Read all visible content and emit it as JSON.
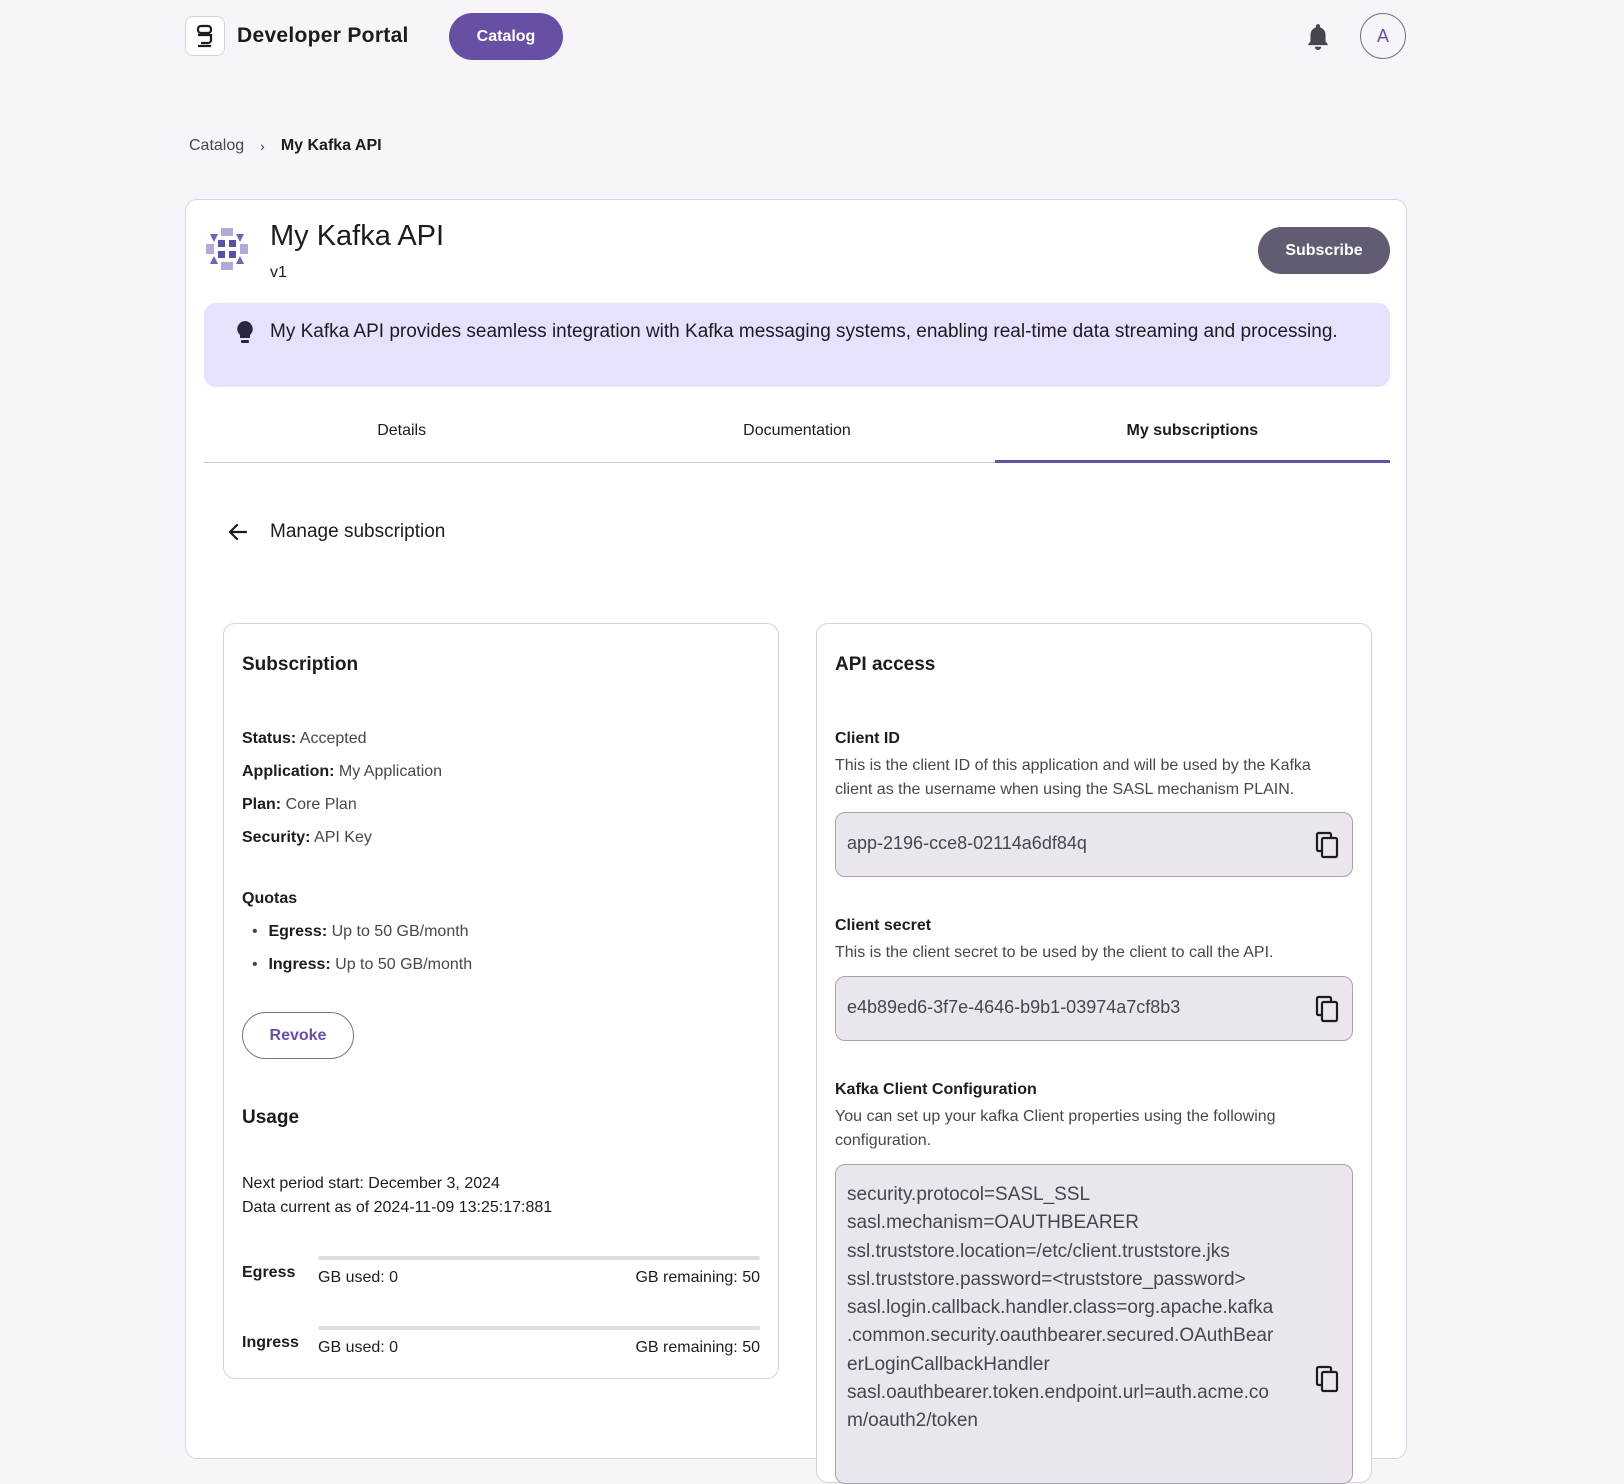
{
  "header": {
    "brand": "Developer Portal",
    "nav_catalog": "Catalog",
    "avatar_initial": "A"
  },
  "breadcrumb": {
    "root": "Catalog",
    "current": "My Kafka API"
  },
  "api": {
    "title": "My Kafka API",
    "version": "v1",
    "subscribe_label": "Subscribe",
    "description": "My Kafka API provides seamless integration with Kafka messaging systems, enabling real-time data streaming and processing."
  },
  "tabs": [
    {
      "label": "Details"
    },
    {
      "label": "Documentation"
    },
    {
      "label": "My subscriptions"
    }
  ],
  "manage": {
    "title": "Manage subscription"
  },
  "subscription": {
    "title": "Subscription",
    "status_label": "Status:",
    "status": "Accepted",
    "application_label": "Application:",
    "application": "My Application",
    "plan_label": "Plan:",
    "plan": "Core Plan",
    "security_label": "Security:",
    "security": "API Key",
    "quotas_label": "Quotas",
    "quotas": [
      {
        "label": "Egress:",
        "value": "Up to 50 GB/month"
      },
      {
        "label": "Ingress:",
        "value": "Up to 50 GB/month"
      }
    ],
    "revoke_label": "Revoke"
  },
  "usage": {
    "title": "Usage",
    "next_period": "Next period start: December 3, 2024",
    "data_current": "Data current as of 2024-11-09 13:25:17:881",
    "rows": [
      {
        "label": "Egress",
        "used": "GB used: 0",
        "remaining": "GB remaining: 50",
        "fraction": 0
      },
      {
        "label": "Ingress",
        "used": "GB used: 0",
        "remaining": "GB remaining: 50",
        "fraction": 0
      }
    ]
  },
  "api_access": {
    "title": "API access",
    "client_id_label": "Client ID",
    "client_id_help": "This is the client ID of this application and will be used by the Kafka client as the username when using the SASL mechanism PLAIN.",
    "client_id": "app-2196-cce8-02114a6df84q",
    "client_secret_label": "Client secret",
    "client_secret_help": "This is the client secret to be used by the client to call the API.",
    "client_secret": "e4b89ed6-3f7e-4646-b9b1-03974a7cf8b3",
    "config_label": "Kafka Client Configuration",
    "config_help": "You can set up your kafka Client properties using the following configuration.",
    "config_lines": [
      "security.protocol=SASL_SSL",
      "sasl.mechanism=OAUTHBEARER",
      "ssl.truststore.location=/etc/client.truststore.jks",
      "ssl.truststore.password=<truststore_password>",
      "sasl.login.callback.handler.class=org.apache.kafka",
      ".common.security.oauthbearer.secured.OAuthBear",
      "erLoginCallbackHandler",
      "sasl.oauthbearer.token.endpoint.url=auth.acme.co",
      "m/oauth2/token"
    ]
  },
  "colors": {
    "primary": "#6750a4",
    "secondary_button": "#625b71",
    "banner": "#e8e0fd",
    "code_bg": "#ebe6ee"
  }
}
